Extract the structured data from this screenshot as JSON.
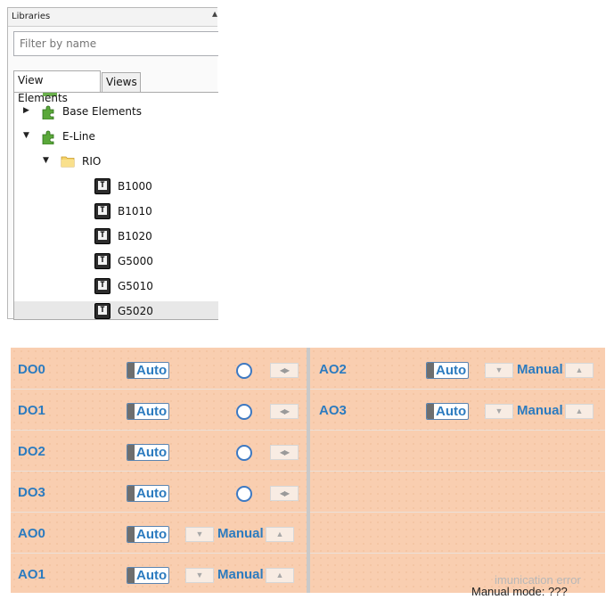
{
  "libraries": {
    "title": "Libraries",
    "filter_placeholder": "Filter by name",
    "tabs": [
      {
        "label": "View Elements",
        "active": true
      },
      {
        "label": "Views",
        "active": false
      }
    ],
    "tree": [
      {
        "label": "Base Elements",
        "level": 0,
        "icon": "puzzle-icon",
        "expanded": false
      },
      {
        "label": "E-Line",
        "level": 0,
        "icon": "puzzle-icon",
        "expanded": true
      },
      {
        "label": "RIO",
        "level": 1,
        "icon": "folder-icon",
        "expanded": true
      },
      {
        "label": "B1000",
        "level": 2,
        "icon": "text-element-icon"
      },
      {
        "label": "B1010",
        "level": 2,
        "icon": "text-element-icon"
      },
      {
        "label": "B1020",
        "level": 2,
        "icon": "text-element-icon"
      },
      {
        "label": "G5000",
        "level": 2,
        "icon": "text-element-icon"
      },
      {
        "label": "G5010",
        "level": 2,
        "icon": "text-element-icon"
      },
      {
        "label": "G5020",
        "level": 2,
        "icon": "text-element-icon",
        "selected": true
      }
    ]
  },
  "control_panel": {
    "colors": {
      "background": "#f9ceb0",
      "label": "#2c7bbf"
    },
    "left_rows": [
      {
        "channel": "DO0",
        "mode": "Auto",
        "type": "digital"
      },
      {
        "channel": "DO1",
        "mode": "Auto",
        "type": "digital"
      },
      {
        "channel": "DO2",
        "mode": "Auto",
        "type": "digital"
      },
      {
        "channel": "DO3",
        "mode": "Auto",
        "type": "digital"
      },
      {
        "channel": "AO0",
        "mode": "Auto",
        "type": "analog",
        "manual": "Manual"
      },
      {
        "channel": "AO1",
        "mode": "Auto",
        "type": "analog",
        "manual": "Manual"
      }
    ],
    "right_rows": [
      {
        "channel": "AO2",
        "mode": "Auto",
        "type": "analog",
        "manual": "Manual"
      },
      {
        "channel": "AO3",
        "mode": "Auto",
        "type": "analog",
        "manual": "Manual"
      }
    ],
    "status": {
      "line1": "imunication error",
      "line2": "Manual mode: ???"
    }
  }
}
